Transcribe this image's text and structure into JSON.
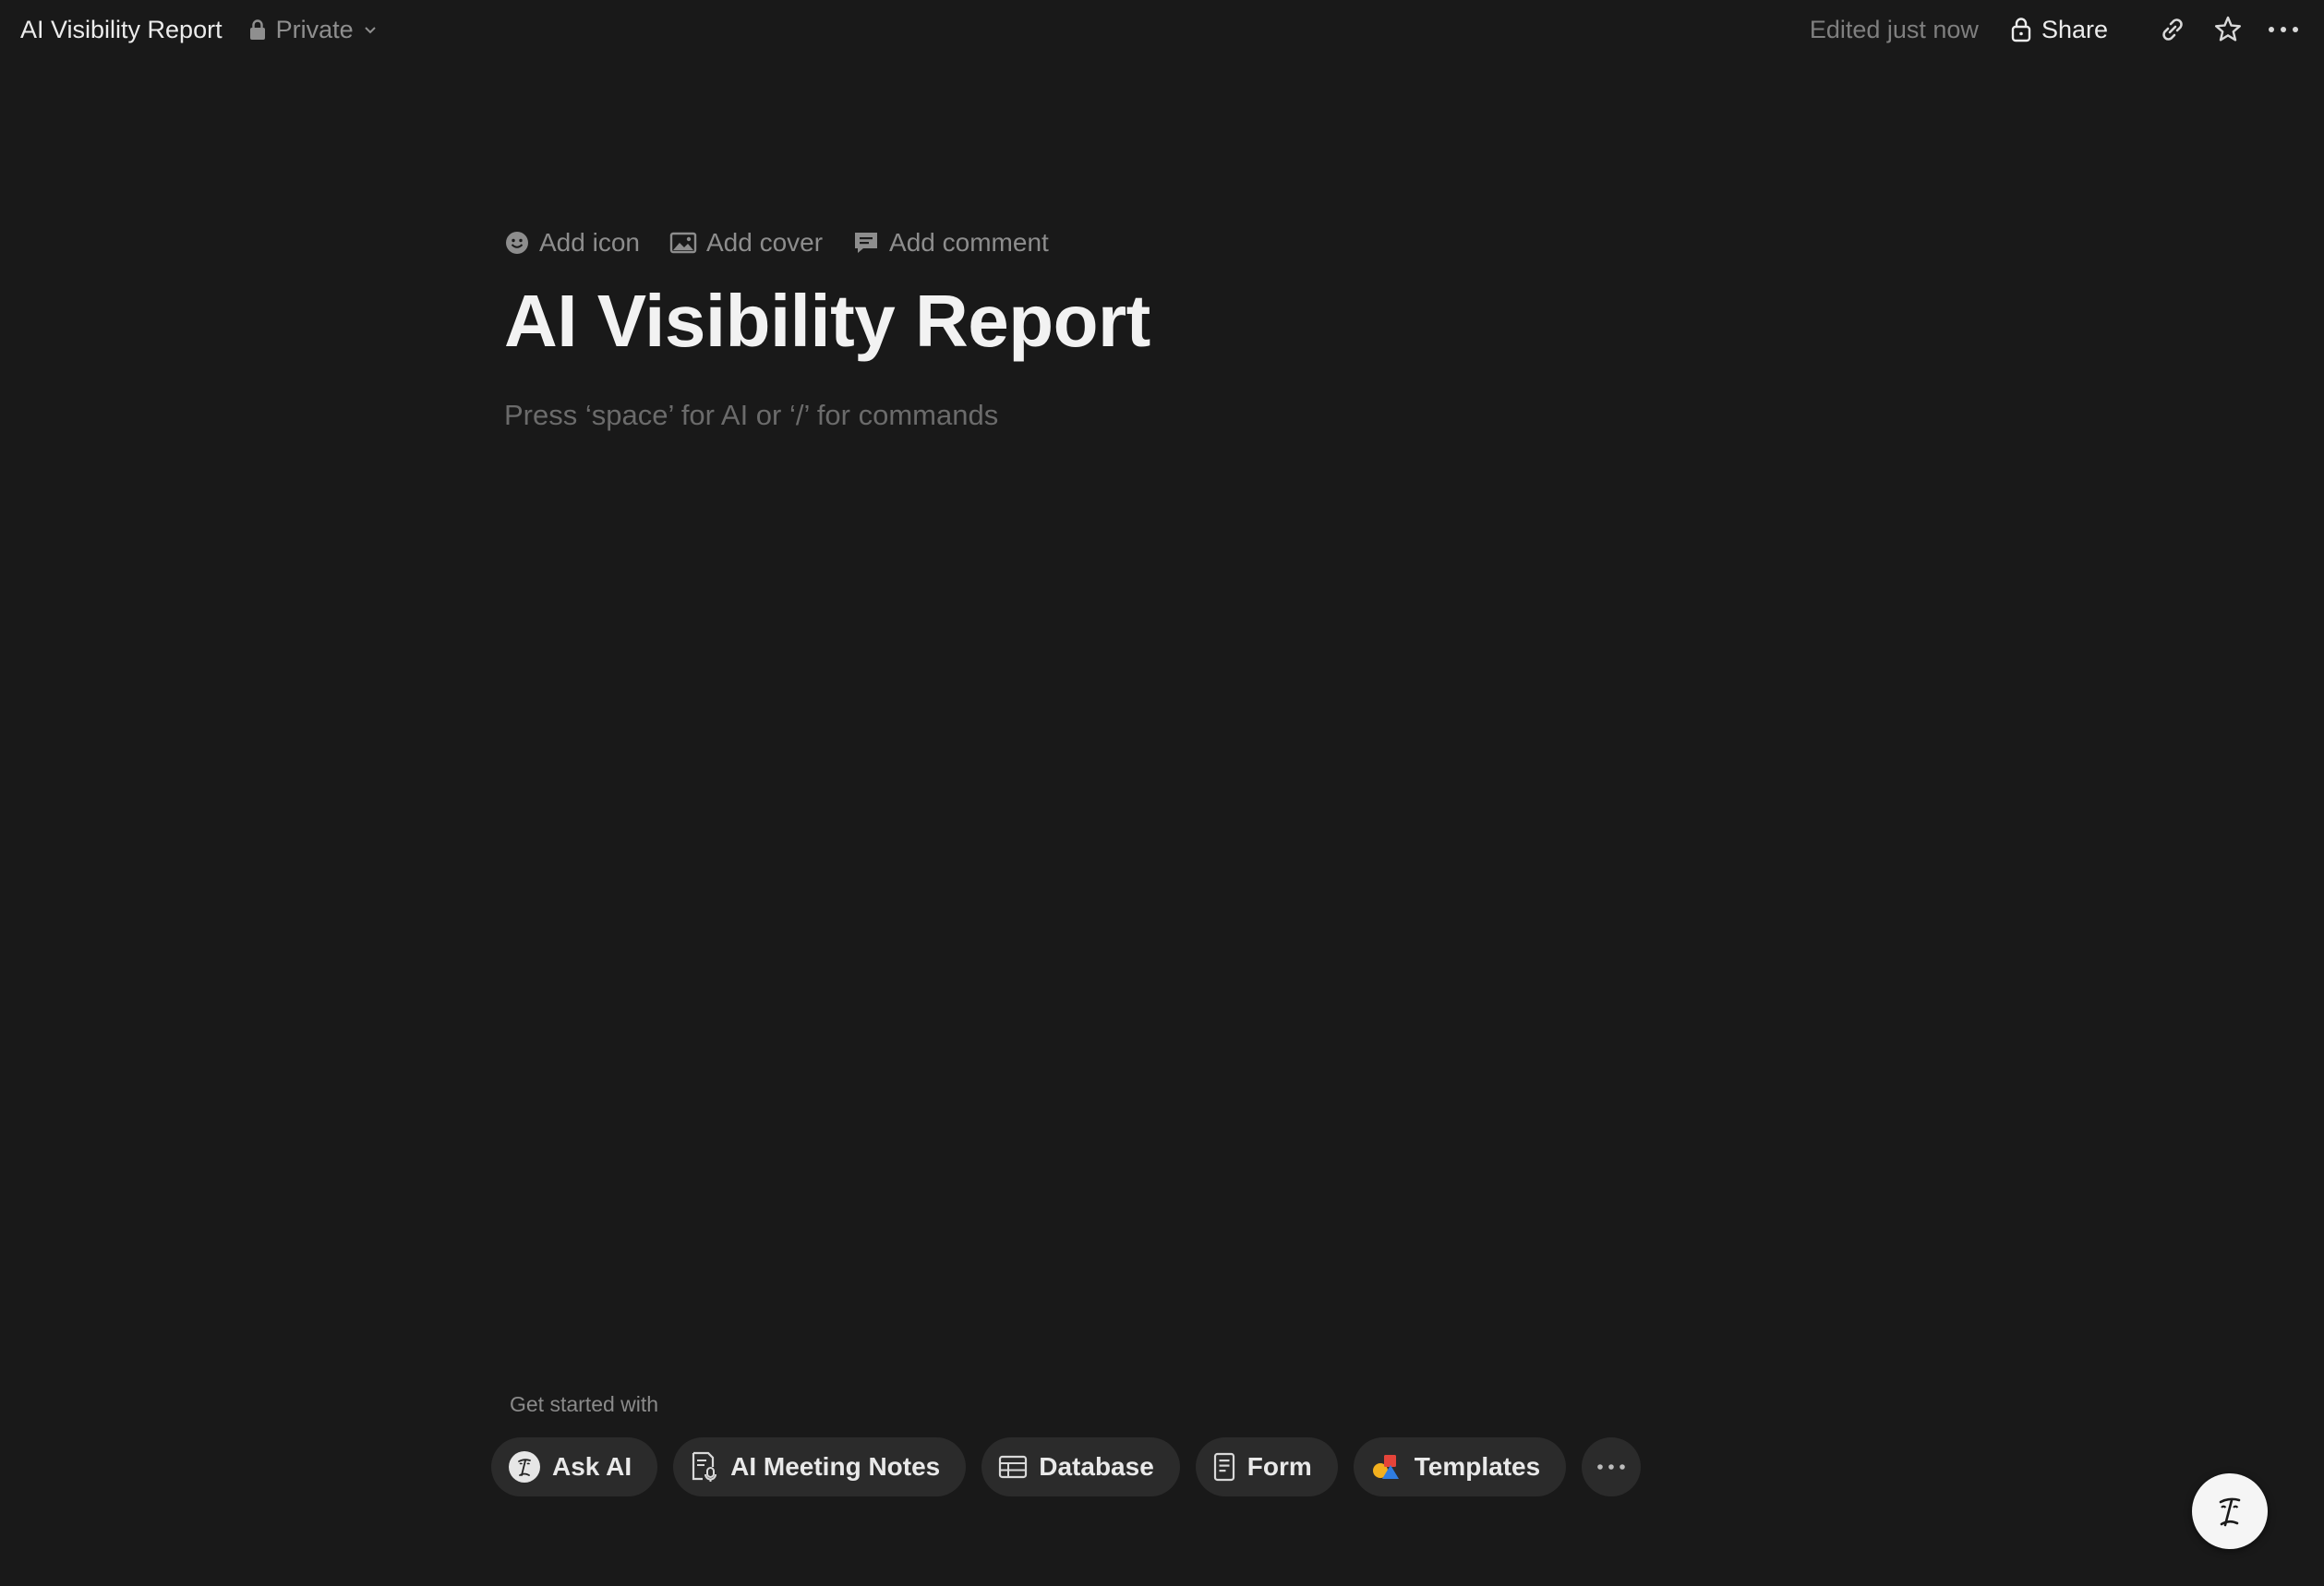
{
  "topbar": {
    "doc_title": "AI Visibility Report",
    "privacy_label": "Private",
    "edited_status": "Edited just now",
    "share_label": "Share"
  },
  "page": {
    "actions": {
      "add_icon": "Add icon",
      "add_cover": "Add cover",
      "add_comment": "Add comment"
    },
    "title": "AI Visibility Report",
    "placeholder": "Press ‘space’ for AI or ‘/’ for commands"
  },
  "get_started": {
    "label": "Get started with",
    "chips": [
      {
        "label": "Ask AI",
        "icon": "ai-face-icon"
      },
      {
        "label": "AI Meeting Notes",
        "icon": "meeting-notes-icon"
      },
      {
        "label": "Database",
        "icon": "table-icon"
      },
      {
        "label": "Form",
        "icon": "form-icon"
      },
      {
        "label": "Templates",
        "icon": "templates-icon"
      }
    ]
  },
  "colors": {
    "background": "#191919",
    "chip_background": "#2b2b2b",
    "text_primary": "#ececec",
    "text_muted": "#8f8f8f"
  }
}
